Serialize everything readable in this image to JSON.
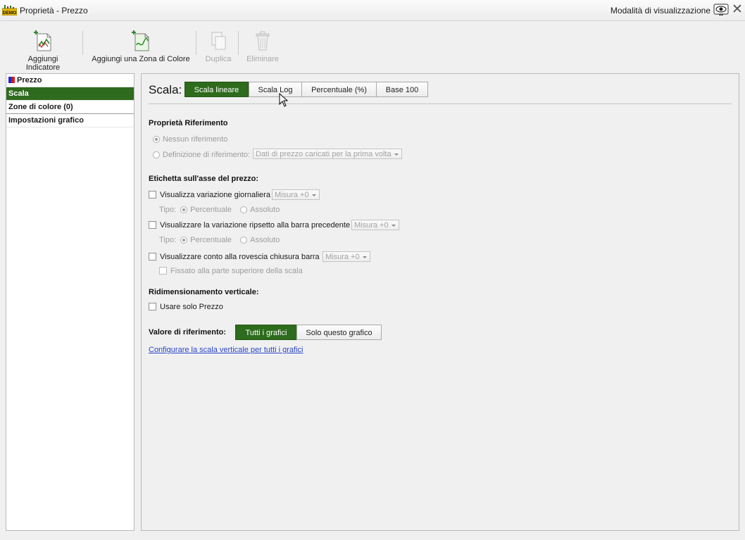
{
  "window": {
    "title": "Proprietà - Prezzo",
    "app_badge": "DEMO",
    "view_mode": "Modalità di visualizzazione"
  },
  "toolbar": {
    "add_indicator": "Aggiungi Indicatore",
    "add_color_zone": "Aggiungi una Zona di Colore",
    "duplicate": "Duplica",
    "delete": "Eliminare"
  },
  "sidebar": {
    "items": [
      {
        "label": "Prezzo"
      },
      {
        "label": "Scala"
      },
      {
        "label": "Zone di colore (0)"
      },
      {
        "label": "Impostazioni grafico"
      }
    ]
  },
  "scale": {
    "label": "Scala:",
    "options": [
      "Scala lineare",
      "Scala Log",
      "Percentuale (%)",
      "Base 100"
    ],
    "selected": "Scala lineare"
  },
  "reference": {
    "heading": "Proprietà Riferimento",
    "none": "Nessun riferimento",
    "definition": "Definizione di riferimento:",
    "definition_value": "Dati di prezzo caricati per la prima volta"
  },
  "axis_label": {
    "heading": "Etichetta sull'asse del prezzo:",
    "daily_change": "Visualizza variazione giornaliera",
    "prev_bar_change": "Visualizzare la variazione ripsetto alla barra precedente",
    "countdown": "Visualizzare conto alla rovescia chiusura barra",
    "measure": "Misura +0",
    "type_label": "Tipo:",
    "percent": "Percentuale",
    "absolute": "Assoluto",
    "fixed_top": "Fissato alla parte superiore della scala"
  },
  "resize": {
    "heading": "Ridimensionamento verticale:",
    "price_only": "Usare solo Prezzo"
  },
  "ref_value": {
    "label": "Valore di riferimento:",
    "all": "Tutti i grafici",
    "this_only": "Solo questo grafico",
    "selected": "Tutti i grafici"
  },
  "link": "Configurare la scala verticale per tutti i grafici",
  "colors": {
    "accent_green": "#2e6b1d",
    "link_blue": "#2a44c9"
  }
}
